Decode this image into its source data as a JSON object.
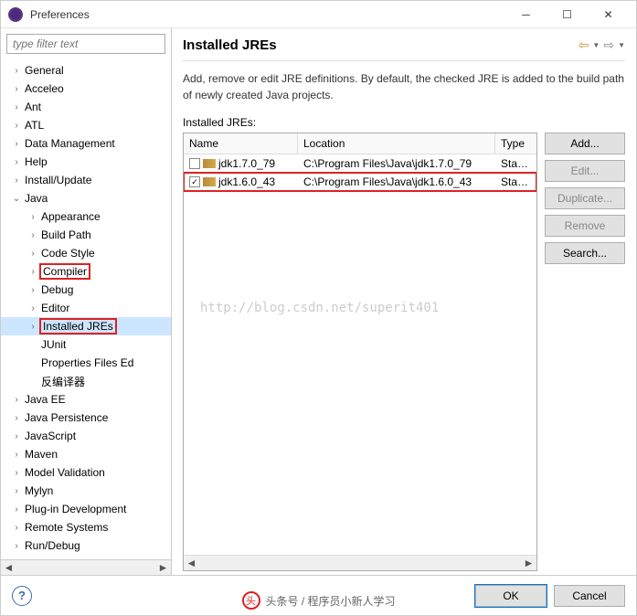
{
  "window": {
    "title": "Preferences"
  },
  "filter": {
    "placeholder": "type filter text"
  },
  "tree": {
    "items": [
      {
        "label": "General",
        "level": 1,
        "arrow": ">"
      },
      {
        "label": "Acceleo",
        "level": 1,
        "arrow": ">"
      },
      {
        "label": "Ant",
        "level": 1,
        "arrow": ">"
      },
      {
        "label": "ATL",
        "level": 1,
        "arrow": ">"
      },
      {
        "label": "Data Management",
        "level": 1,
        "arrow": ">"
      },
      {
        "label": "Help",
        "level": 1,
        "arrow": ">"
      },
      {
        "label": "Install/Update",
        "level": 1,
        "arrow": ">"
      },
      {
        "label": "Java",
        "level": 1,
        "arrow": "v"
      },
      {
        "label": "Appearance",
        "level": 2,
        "arrow": ">"
      },
      {
        "label": "Build Path",
        "level": 2,
        "arrow": ">"
      },
      {
        "label": "Code Style",
        "level": 2,
        "arrow": ">"
      },
      {
        "label": "Compiler",
        "level": 2,
        "arrow": ">",
        "highlight": true
      },
      {
        "label": "Debug",
        "level": 2,
        "arrow": ">"
      },
      {
        "label": "Editor",
        "level": 2,
        "arrow": ">"
      },
      {
        "label": "Installed JREs",
        "level": 2,
        "arrow": ">",
        "highlight": true,
        "selected": true
      },
      {
        "label": "JUnit",
        "level": 2,
        "arrow": ""
      },
      {
        "label": "Properties Files Ed",
        "level": 2,
        "arrow": ""
      },
      {
        "label": "反编译器",
        "level": 2,
        "arrow": ""
      },
      {
        "label": "Java EE",
        "level": 1,
        "arrow": ">"
      },
      {
        "label": "Java Persistence",
        "level": 1,
        "arrow": ">"
      },
      {
        "label": "JavaScript",
        "level": 1,
        "arrow": ">"
      },
      {
        "label": "Maven",
        "level": 1,
        "arrow": ">"
      },
      {
        "label": "Model Validation",
        "level": 1,
        "arrow": ">"
      },
      {
        "label": "Mylyn",
        "level": 1,
        "arrow": ">"
      },
      {
        "label": "Plug-in Development",
        "level": 1,
        "arrow": ">"
      },
      {
        "label": "Remote Systems",
        "level": 1,
        "arrow": ">"
      },
      {
        "label": "Run/Debug",
        "level": 1,
        "arrow": ">"
      }
    ]
  },
  "page": {
    "title": "Installed JREs",
    "description": "Add, remove or edit JRE definitions. By default, the checked JRE is added to the build path of newly created Java projects.",
    "list_label": "Installed JREs:",
    "columns": {
      "name": "Name",
      "location": "Location",
      "type": "Type"
    },
    "rows": [
      {
        "checked": true,
        "name": "jdk1.6.0_43",
        "location": "C:\\Program Files\\Java\\jdk1.6.0_43",
        "type": "Standa",
        "highlight": true
      },
      {
        "checked": false,
        "name": "jdk1.7.0_79",
        "location": "C:\\Program Files\\Java\\jdk1.7.0_79",
        "type": "Standa",
        "highlight": false
      }
    ],
    "watermark": "http://blog.csdn.net/superit401",
    "buttons": {
      "add": "Add...",
      "edit": "Edit...",
      "duplicate": "Duplicate...",
      "remove": "Remove",
      "search": "Search..."
    }
  },
  "footer": {
    "ok": "OK",
    "cancel": "Cancel"
  },
  "credit": "头条号 / 程序员小新人学习"
}
